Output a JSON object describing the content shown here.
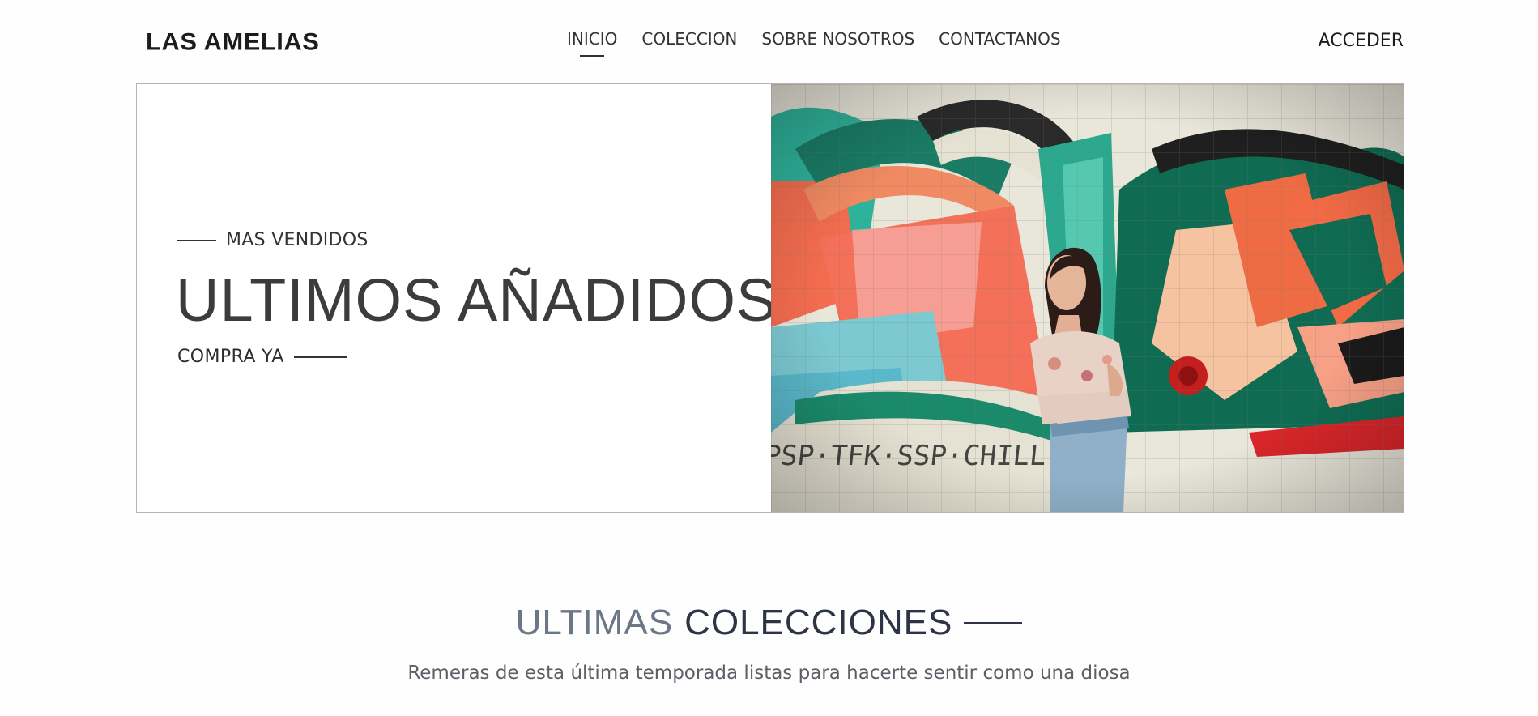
{
  "header": {
    "logo": "LAS AMELIAS",
    "nav": [
      {
        "label": "INICIO",
        "active": true
      },
      {
        "label": "COLECCION",
        "active": false
      },
      {
        "label": "SOBRE NOSOTROS",
        "active": false
      },
      {
        "label": "CONTACTANOS",
        "active": false
      }
    ],
    "login_label": "ACCEDER"
  },
  "hero": {
    "eyebrow": "MAS VENDIDOS",
    "title": "ULTIMOS AÑADIDOS",
    "cta": "COMPRA YA",
    "graffiti_text": "PSP · TFK · SSP · CHILL"
  },
  "section": {
    "title_light": "ULTIMAS",
    "title_bold": "COLECCIONES",
    "subtitle": "Remeras de esta última temporada listas para hacerte sentir como una diosa"
  },
  "colors": {
    "text_dark": "#333333",
    "section_title_dark": "#2d3445",
    "section_title_light": "#6b7686",
    "graffiti_green": "#14806b",
    "graffiti_orange": "#f36c4f",
    "graffiti_teal": "#3ec2b1"
  }
}
